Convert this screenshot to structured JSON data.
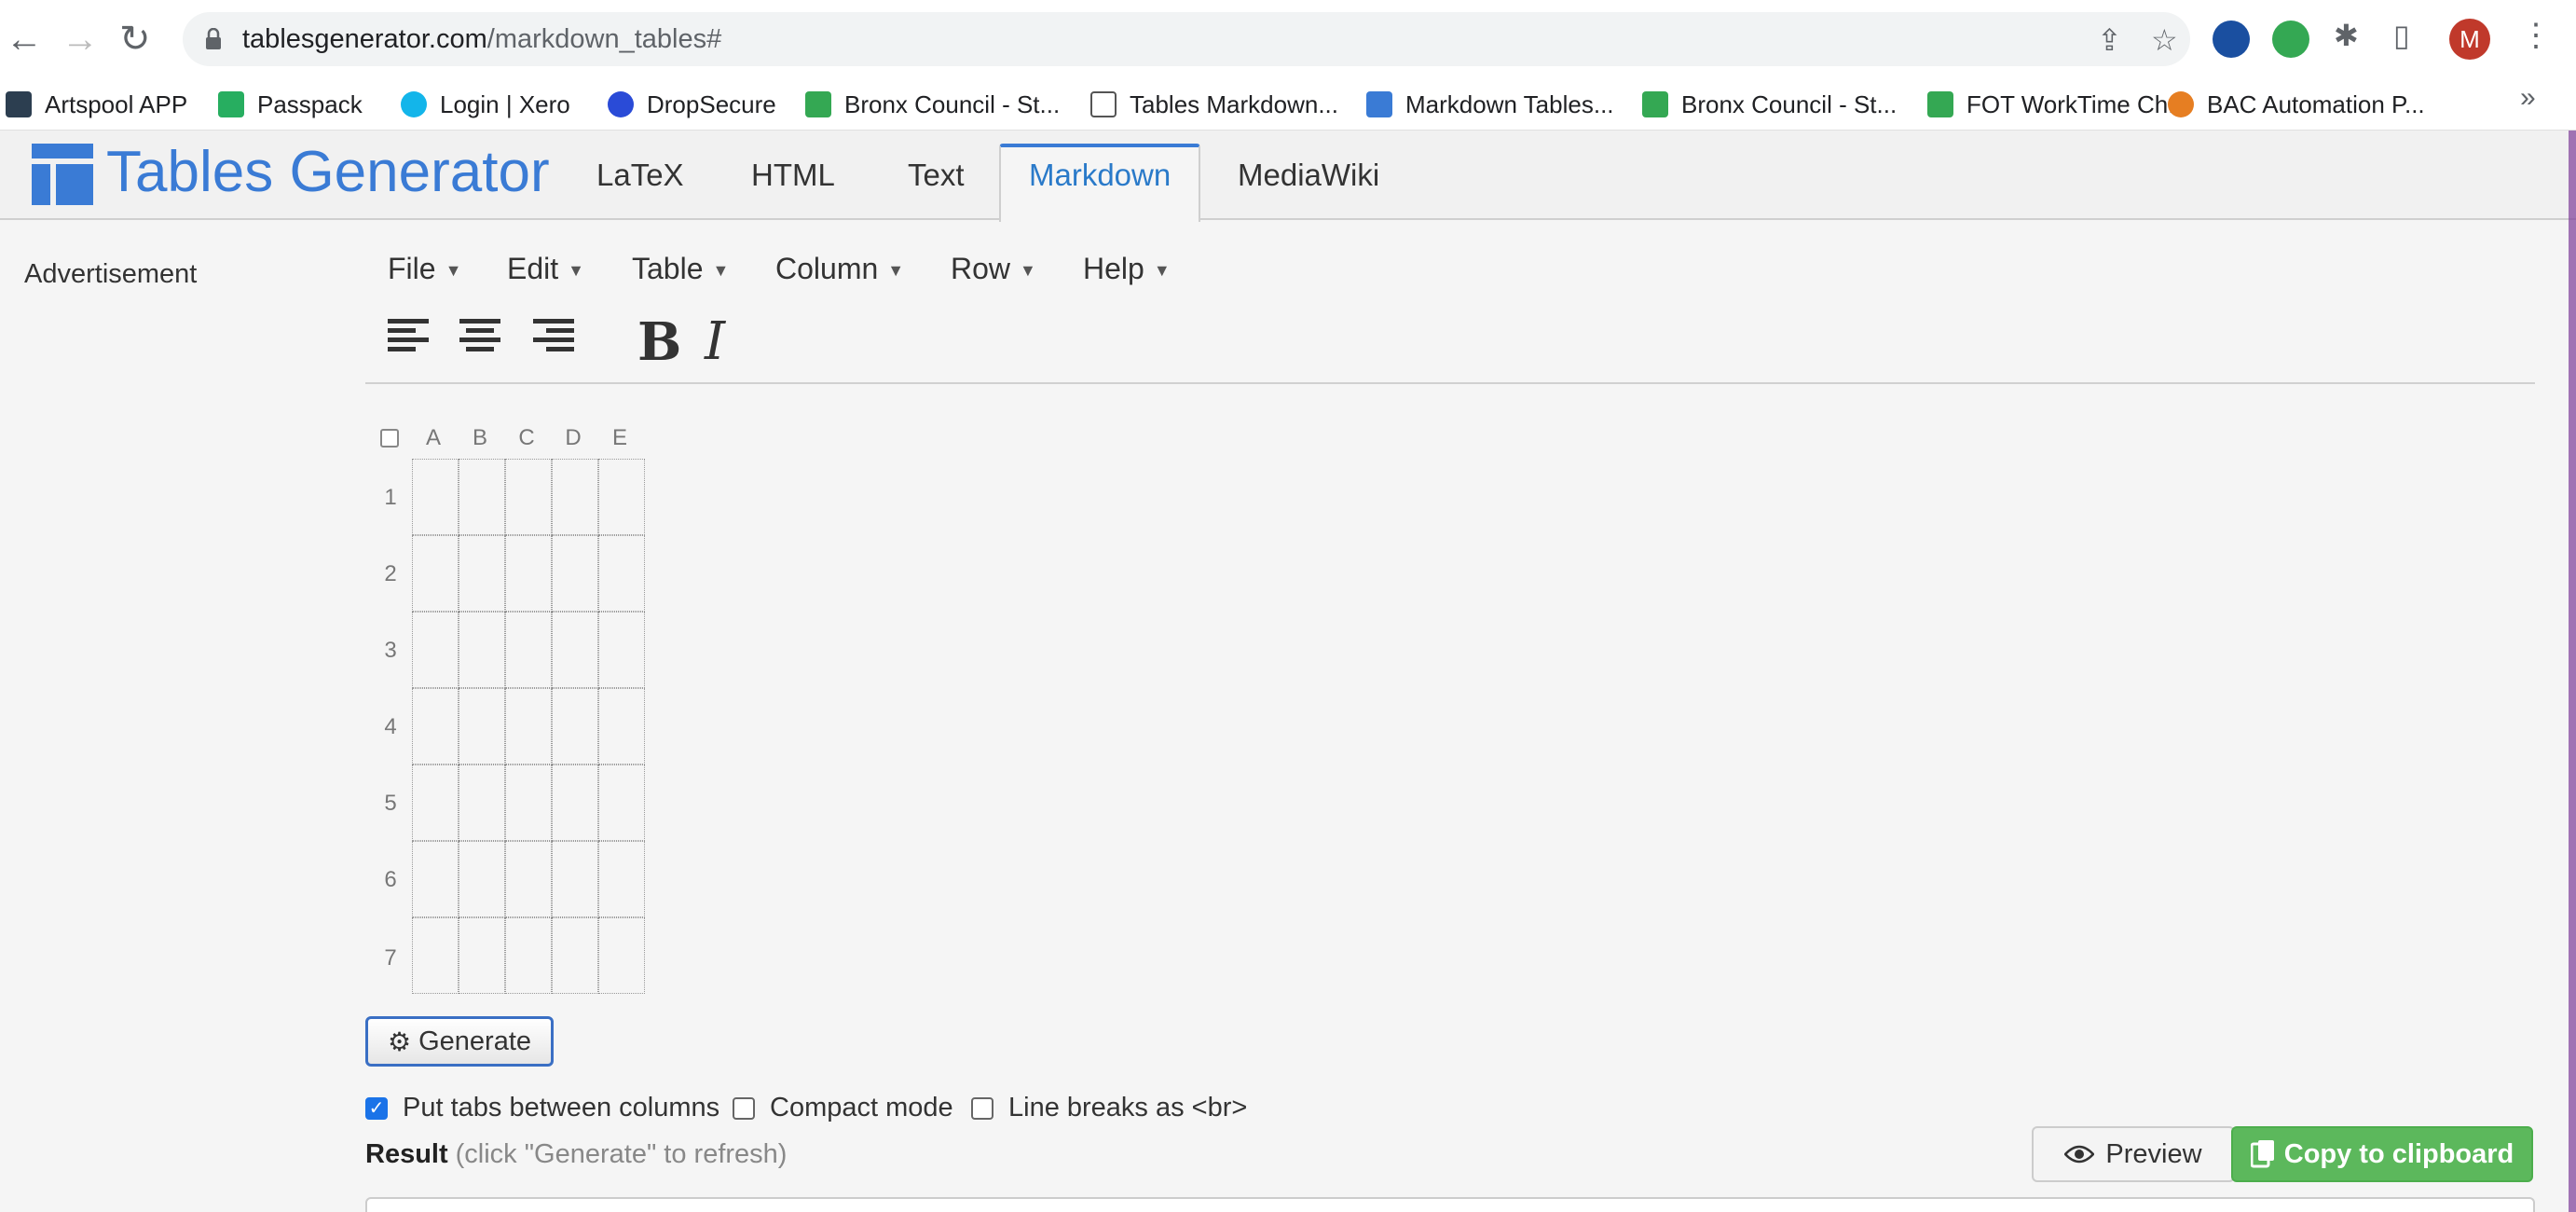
{
  "browser": {
    "url_host": "tablesgenerator.com",
    "url_path": "/markdown_tables#",
    "avatar_letter": "M",
    "bookmarks": [
      {
        "label": "Artspool APP",
        "color": "#2c3e50"
      },
      {
        "label": "Passpack",
        "color": "#27ae60"
      },
      {
        "label": "Login | Xero",
        "color": "#13b5ea"
      },
      {
        "label": "DropSecure",
        "color": "#2a4bd7"
      },
      {
        "label": "Bronx Council - St...",
        "color": "#34a853"
      },
      {
        "label": "Tables Markdown...",
        "color": "#555555"
      },
      {
        "label": "Markdown Tables...",
        "color": "#3a7bd5"
      },
      {
        "label": "Bronx Council - St...",
        "color": "#34a853"
      },
      {
        "label": "FOT WorkTime Ch...",
        "color": "#34a853"
      },
      {
        "label": "BAC Automation P...",
        "color": "#e67e22"
      }
    ]
  },
  "site": {
    "brand": "Tables Generator",
    "brand_color": "#3a7bd5",
    "tabs": [
      {
        "label": "LaTeX",
        "active": false
      },
      {
        "label": "HTML",
        "active": false
      },
      {
        "label": "Text",
        "active": false
      },
      {
        "label": "Markdown",
        "active": true
      },
      {
        "label": "MediaWiki",
        "active": false
      }
    ]
  },
  "sidebar": {
    "advertisement": "Advertisement"
  },
  "menu": [
    "File",
    "Edit",
    "Table",
    "Column",
    "Row",
    "Help"
  ],
  "toolbar": {
    "bold": "B",
    "italic": "I"
  },
  "grid": {
    "columns": [
      "A",
      "B",
      "C",
      "D",
      "E"
    ],
    "rows": [
      "1",
      "2",
      "3",
      "4",
      "5",
      "6",
      "7"
    ]
  },
  "generate_label": "Generate",
  "options": [
    {
      "label": "Put tabs between columns",
      "checked": true
    },
    {
      "label": "Compact mode",
      "checked": false
    },
    {
      "label": "Line breaks as <br>",
      "checked": false
    }
  ],
  "result": {
    "label": "Result",
    "hint": "(click \"Generate\" to refresh)",
    "preview_label": "Preview",
    "copy_label": "Copy to clipboard",
    "copy_color": "#5cb85c"
  }
}
